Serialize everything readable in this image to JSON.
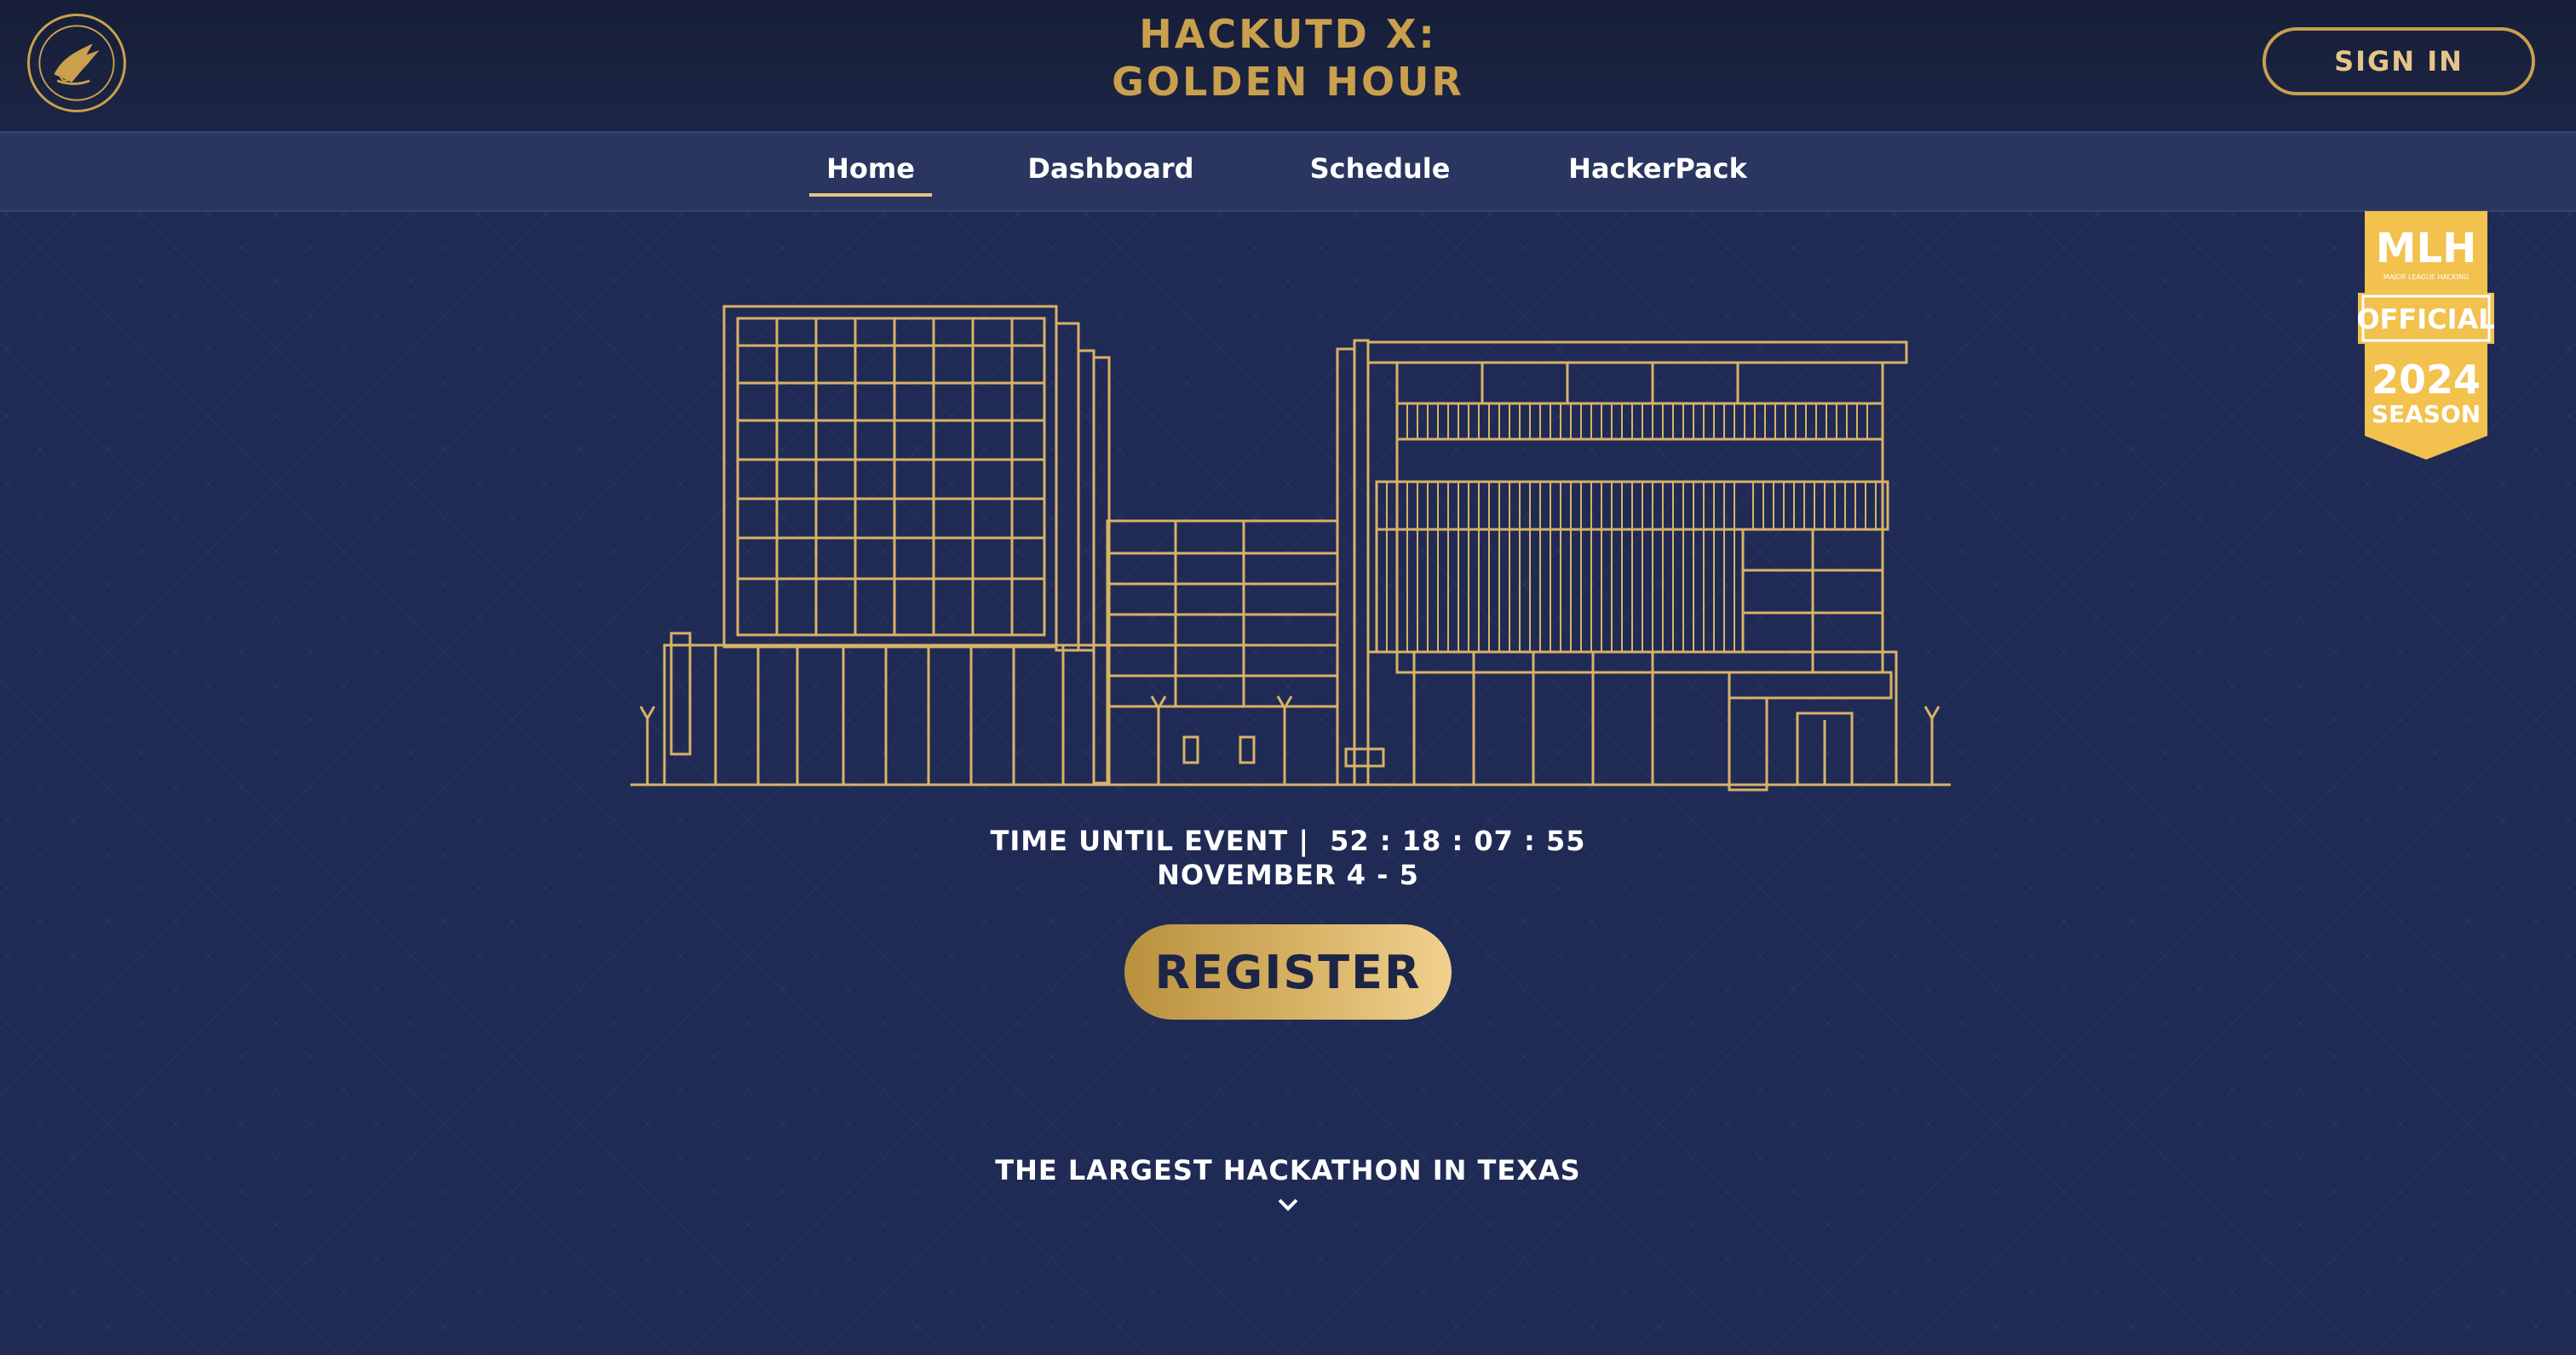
{
  "header": {
    "title_line1": "HACKUTD X:",
    "title_line2": "GOLDEN HOUR",
    "signin_label": "SIGN IN",
    "logo_icon": "hackutd-logo-icon"
  },
  "nav": {
    "items": [
      {
        "label": "Home",
        "active": true
      },
      {
        "label": "Dashboard",
        "active": false
      },
      {
        "label": "Schedule",
        "active": false
      },
      {
        "label": "HackerPack",
        "active": false
      }
    ]
  },
  "hero": {
    "illustration_icon": "building-outline-icon",
    "countdown_label": "TIME UNTIL EVENT |",
    "countdown_value": "52 : 18 : 07 : 55",
    "dates": "NOVEMBER 4 - 5",
    "register_label": "REGISTER",
    "tagline": "THE LARGEST HACKATHON IN TEXAS",
    "scroll_icon": "chevron-down-icon"
  },
  "mlh_badge": {
    "line1": "MLH",
    "line2": "MAJOR LEAGUE HACKING",
    "line3": "OFFICIAL",
    "line4": "2024",
    "line5": "SEASON"
  },
  "colors": {
    "background": "#1e2a52",
    "nav": "#2a3660",
    "gold": "#c9a04d",
    "gold_light": "#f0d18f",
    "text": "#ffffff"
  }
}
